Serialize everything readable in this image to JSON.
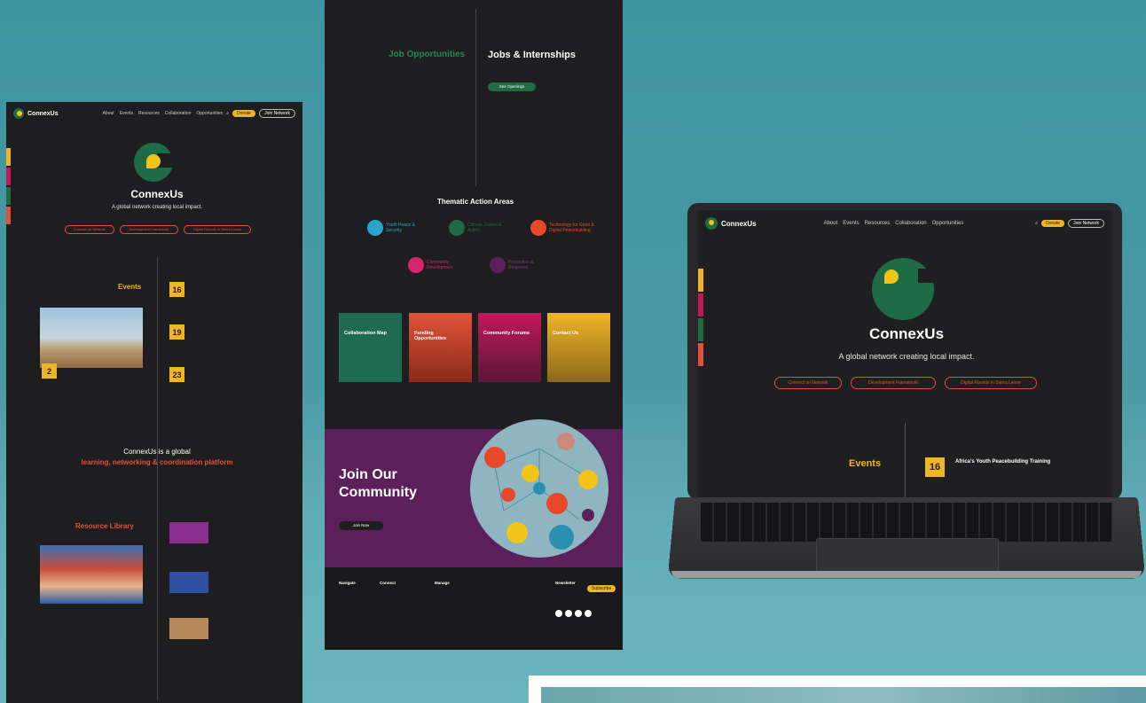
{
  "brand": {
    "name": "ConnexUs",
    "tagline": "A global network creating local impact."
  },
  "nav": {
    "links": [
      "About",
      "Events",
      "Resources",
      "Collaboration",
      "Opportunities"
    ],
    "cta_yellow": "Donate",
    "cta_outline": "Join Network"
  },
  "hero": {
    "buttons": [
      "Connect on Network",
      "Development Framework",
      "Digital Rounds in Sierra Leone"
    ]
  },
  "events": {
    "title": "Events",
    "dates": [
      "16",
      "19",
      "23",
      "2"
    ],
    "laptop_event": {
      "date": "16",
      "heading": "Africa's Youth Peacebuilding Training"
    }
  },
  "platform": {
    "line1": "ConnexUs is a global",
    "line2": "learning, networking & coordination platform"
  },
  "resources": {
    "title": "Resource Library"
  },
  "jobs": {
    "left_title": "Job Opportunities",
    "right_title": "Jobs & Internships",
    "button": "See Openings"
  },
  "thematic": {
    "title": "Thematic Action Areas",
    "areas": [
      "Youth Peace & Security",
      "Climate Justice & Action",
      "Technology for Good & Digital Peacebuilding",
      "Community Development",
      "Prevention & Response"
    ]
  },
  "cards": [
    "Collaboration Map",
    "Funding Opportunities",
    "Community Forums",
    "Contact Us"
  ],
  "join": {
    "title": "Join Our Community",
    "button": "Join Now"
  },
  "footer": {
    "cols": [
      "Navigate",
      "Connect",
      "Manage",
      "Newsletter"
    ],
    "subscribe": "Subscribe"
  },
  "colors": {
    "accent_yellow": "#f0b429",
    "accent_red": "#e0533a",
    "brand_green": "#1f6b45",
    "purple": "#5b1f5a",
    "teal_bg": "#4a9aa6"
  }
}
